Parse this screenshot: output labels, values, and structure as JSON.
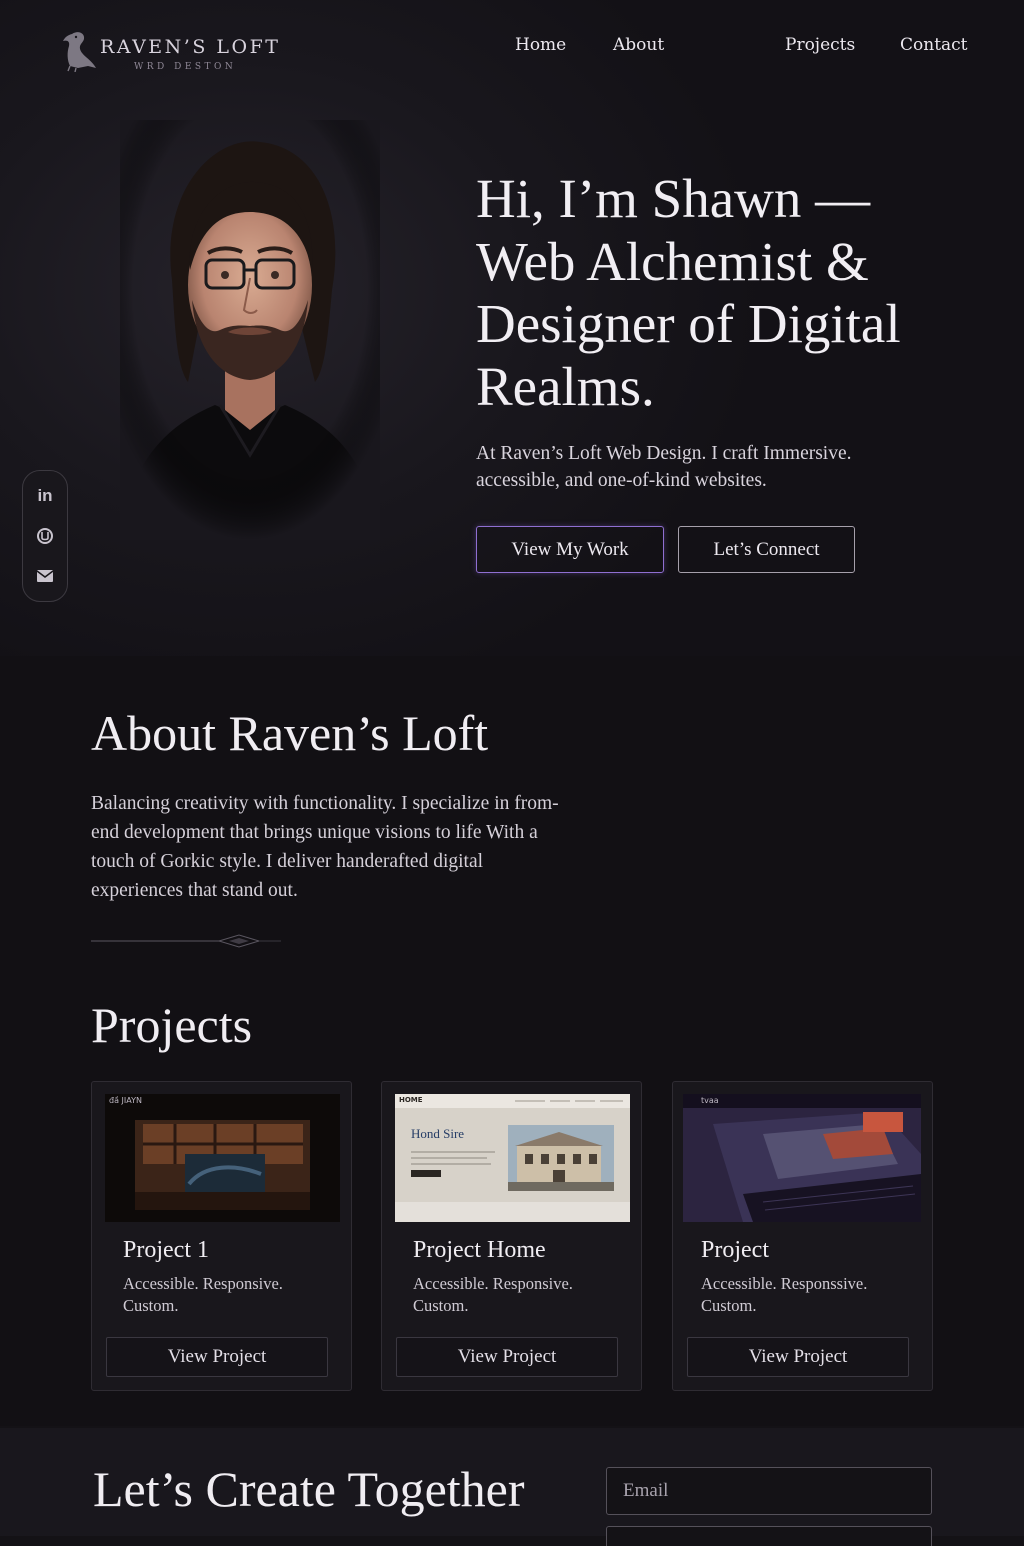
{
  "brand": {
    "name": "RAVEN’S LOFT",
    "tagline": "WRD DESTON"
  },
  "nav": [
    {
      "label": "Home"
    },
    {
      "label": "About"
    },
    {
      "label": "Projects"
    },
    {
      "label": "Contact"
    }
  ],
  "hero": {
    "title": "Hi, I’m Shawn — Web Alchemist & Designer of Digital Realms.",
    "subtitle": "At Raven’s Loft Web Design. I craft Immersive. accessible, and one-of-kind websites.",
    "primary_button": "View My Work",
    "secondary_button": "Let’s Connect"
  },
  "social": [
    {
      "icon": "linkedin-icon",
      "label": "in"
    },
    {
      "icon": "github-icon"
    },
    {
      "icon": "mail-icon"
    }
  ],
  "about": {
    "title": "About Raven’s Loft",
    "body": "Balancing creativity with functionality. I specialize in from-end development that brings unique visions to life  With a touch of Gorkic style. I deliver handerafted digital experiences that stand out."
  },
  "projects": {
    "title": "Projects",
    "items": [
      {
        "title": "Project 1",
        "description": "Accessible. Responsive. Custom.",
        "button": "View Project",
        "thumb_brand": "đầ JIAYN",
        "thumb_text": ""
      },
      {
        "title": "Project Home",
        "description": "Accessible. Responsive. Custom.",
        "button": "View Project",
        "thumb_brand": "HOME",
        "thumb_text": "Hond Sire"
      },
      {
        "title": "Project",
        "description": "Accessible. Responssive. Custom.",
        "button": "View Project",
        "thumb_brand": "tvaa",
        "thumb_text": ""
      }
    ]
  },
  "contact": {
    "title": "Let’s Create Together",
    "email_placeholder": "Email"
  },
  "colors": {
    "background": "#141216",
    "accent": "#8f6fd1",
    "text": "#f0edf2"
  }
}
